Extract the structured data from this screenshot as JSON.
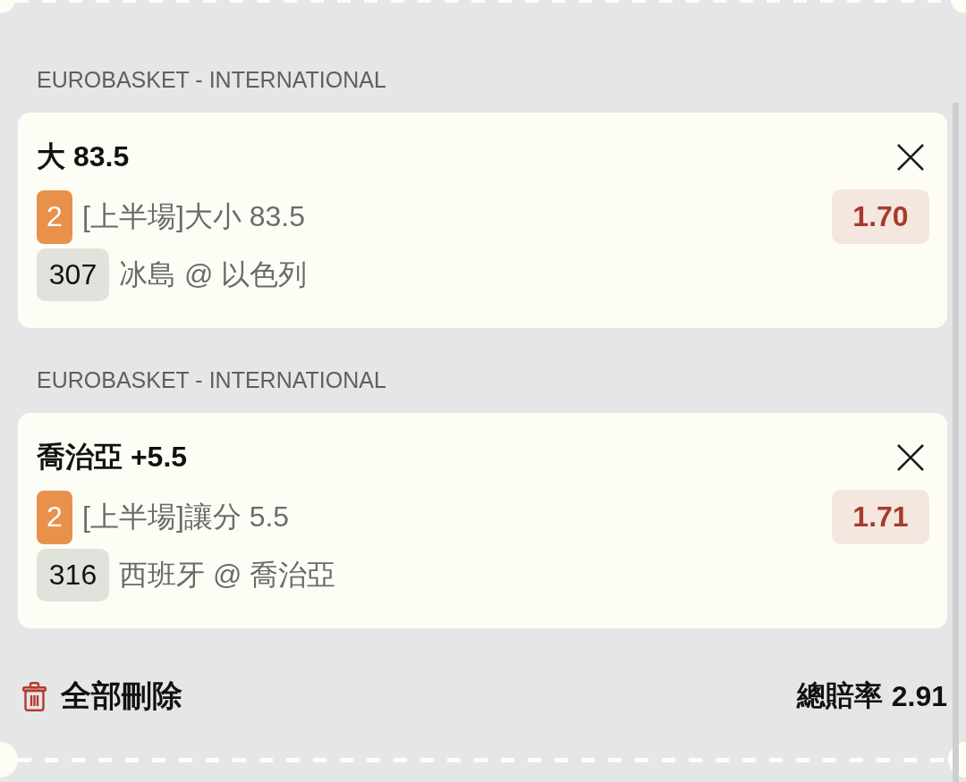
{
  "bets": [
    {
      "league": "EUROBASKET - INTERNATIONAL",
      "selection": "大 83.5",
      "leg_badge": "2",
      "market": "[上半場]大小 83.5",
      "odds": "1.70",
      "match_no": "307",
      "match": "冰島 @ 以色列"
    },
    {
      "league": "EUROBASKET - INTERNATIONAL",
      "selection": "喬治亞 +5.5",
      "leg_badge": "2",
      "market": "[上半場]讓分 5.5",
      "odds": "1.71",
      "match_no": "316",
      "match": "西班牙 @ 喬治亞"
    }
  ],
  "footer": {
    "delete_all": "全部刪除",
    "total_label": "總賠率",
    "total_odds": "2.91"
  }
}
